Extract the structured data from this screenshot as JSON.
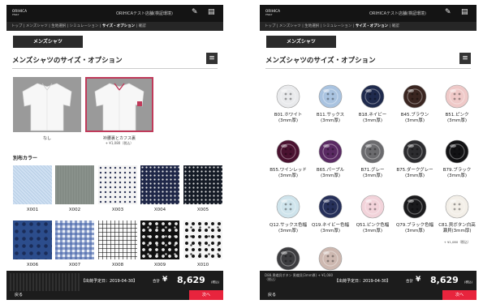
{
  "left": {
    "brand": [
      "ORIHICA",
      "ITALY"
    ],
    "shop_name": "ORIHICAテスト店舗(検証環境)",
    "breadcrumb": [
      {
        "label": "トップ",
        "current": false
      },
      {
        "label": "メンズシャツ",
        "current": false
      },
      {
        "label": "生地選択",
        "current": false
      },
      {
        "label": "シミュレーション",
        "current": false
      },
      {
        "label": "サイズ・オプション",
        "current": true
      },
      {
        "label": "確認",
        "current": false
      }
    ],
    "category_button": "メンズシャツ",
    "page_title": "メンズシャツのサイズ・オプション",
    "menu_icon": "hamburger-icon",
    "collar_options": [
      {
        "label": "なし",
        "price": "",
        "selected": false
      },
      {
        "label": "衿腰裏とカフス裏",
        "price": "+ ¥1,080（税込）",
        "selected": true
      }
    ],
    "section_title": "別布カラー",
    "fabrics": [
      {
        "code": "X001",
        "pattern": "light-blue-oxford"
      },
      {
        "code": "X002",
        "pattern": "grey-melange"
      },
      {
        "code": "X003",
        "pattern": "white-navy-dot"
      },
      {
        "code": "X004",
        "pattern": "navy-white-dot"
      },
      {
        "code": "X005",
        "pattern": "black-white-dot"
      },
      {
        "code": "X006",
        "pattern": "navy-blue-dot"
      },
      {
        "code": "X007",
        "pattern": "blue-gingham"
      },
      {
        "code": "X008",
        "pattern": "white-black-check"
      },
      {
        "code": "X009",
        "pattern": "black-floral"
      },
      {
        "code": "X010",
        "pattern": "white-floral"
      }
    ],
    "footer": {
      "deadline": "【出荷予定日：2019-04-30】",
      "total_label": "合計",
      "yen": "¥",
      "amount": "8,629",
      "tax": "(税込)",
      "back": "戻る",
      "next": "次へ"
    }
  },
  "right": {
    "brand": [
      "ORIHICA",
      "ITALY"
    ],
    "shop_name": "ORIHICAテスト店舗(検証環境)",
    "breadcrumb": [
      {
        "label": "トップ",
        "current": false
      },
      {
        "label": "メンズシャツ",
        "current": false
      },
      {
        "label": "生地選択",
        "current": false
      },
      {
        "label": "シミュレーション",
        "current": false
      },
      {
        "label": "サイズ・オプション",
        "current": true
      },
      {
        "label": "確認",
        "current": false
      }
    ],
    "category_button": "メンズシャツ",
    "page_title": "メンズシャツのサイズ・オプション",
    "menu_icon": "hamburger-icon",
    "buttons": [
      {
        "name": "B01.ホワイト",
        "sub": "(3mm厚)",
        "color": "#e9eaec",
        "price": ""
      },
      {
        "name": "B11.サックス",
        "sub": "(3mm厚)",
        "color": "#a9c3e0",
        "price": ""
      },
      {
        "name": "B18.ネイビー",
        "sub": "(3mm厚)",
        "color": "#1f2a4d",
        "price": ""
      },
      {
        "name": "B45.ブラウン",
        "sub": "(3mm厚)",
        "color": "#3a2520",
        "price": ""
      },
      {
        "name": "B51.ピンク",
        "sub": "(3mm厚)",
        "color": "#efc9c8",
        "price": ""
      },
      {
        "name": "B55.ワインレッド(3mm厚)",
        "sub": "",
        "color": "#4a1230",
        "price": ""
      },
      {
        "name": "B65.パープル",
        "sub": "(3mm厚)",
        "color": "#5a2a63",
        "price": ""
      },
      {
        "name": "B71.グレー",
        "sub": "(3mm厚)",
        "color": "#6b6b6e",
        "price": ""
      },
      {
        "name": "B75.ダークグレー(3mm厚)",
        "sub": "",
        "color": "#2c2c2f",
        "price": ""
      },
      {
        "name": "B79.ブラック",
        "sub": "(3mm厚)",
        "color": "#121214",
        "price": ""
      },
      {
        "name": "Q12.サックス色幅(3mm厚)",
        "sub": "",
        "color": "#cfe4ec",
        "price": ""
      },
      {
        "name": "Q19.ネイビー色幅(3mm厚)",
        "sub": "",
        "color": "#26305a",
        "price": ""
      },
      {
        "name": "Q51.ピンク色幅(3mm厚)",
        "sub": "",
        "color": "#f2d3da",
        "price": ""
      },
      {
        "name": "Q79.ブラック色幅(3mm厚)",
        "sub": "",
        "color": "#1a1a1c",
        "price": ""
      },
      {
        "name": "C81.貝ボタン白高瀬貝(3mm厚)",
        "sub": "",
        "color": "#f3efe8",
        "price": "+ ¥1,080（税込）"
      },
      {
        "name": "",
        "sub": "",
        "color": "#3d3d40",
        "price": ""
      },
      {
        "name": "",
        "sub": "",
        "color": "#cdb8b0",
        "price": ""
      }
    ],
    "footer": {
      "deadline": "【出荷予定日：2019-04-30】",
      "total_label": "合計",
      "yen": "¥",
      "amount": "8,629",
      "tax": "(税込)",
      "back": "戻る",
      "next": "次へ",
      "ghost_text": "D88.黒蝶貝ボタン 黒蝶貝(3mm厚) + ¥1,080（税込）"
    }
  }
}
